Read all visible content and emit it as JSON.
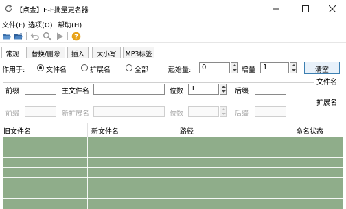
{
  "window": {
    "title": "【点金】E-F批量更名器",
    "icon": "refresh-arrow-icon"
  },
  "menu": {
    "items": [
      "文件(F)",
      "选项(O)",
      "帮助(H)"
    ]
  },
  "toolbar": {
    "buttons": [
      "open-folder-icon",
      "save-icon",
      "undo-icon",
      "preview-icon",
      "run-icon",
      "help-icon"
    ]
  },
  "tabs": [
    "常规",
    "替换/删除",
    "插入",
    "大小写",
    "MP3标签"
  ],
  "options": {
    "apply_to_label": "作用于:",
    "radios": [
      "文件名",
      "扩展名",
      "全部"
    ],
    "start_label": "起始量:",
    "start_value": "0",
    "step_label": "增量",
    "step_value": "1",
    "clear_button": "清空"
  },
  "filename_group": {
    "title": "文件名",
    "prefix_label": "前缀",
    "prefix_value": "",
    "main_label": "主文件名",
    "main_value": "",
    "digits_label": "位数",
    "digits_value": "1",
    "suffix_label": "后缀",
    "suffix_value": ""
  },
  "extension_group": {
    "title": "扩展名",
    "prefix_label": "前缀",
    "prefix_value": "",
    "main_label": "新扩展名",
    "main_value": "",
    "digits_label": "位数",
    "digits_value": "",
    "suffix_label": "后缀",
    "suffix_value": ""
  },
  "table": {
    "columns": [
      "旧文件名",
      "新文件名",
      "路径",
      "命名状态"
    ],
    "rows": []
  },
  "colors": {
    "grid_fill": "#8fad8a",
    "accent": "#3c7fb1",
    "help_icon": "#e8a31a"
  }
}
